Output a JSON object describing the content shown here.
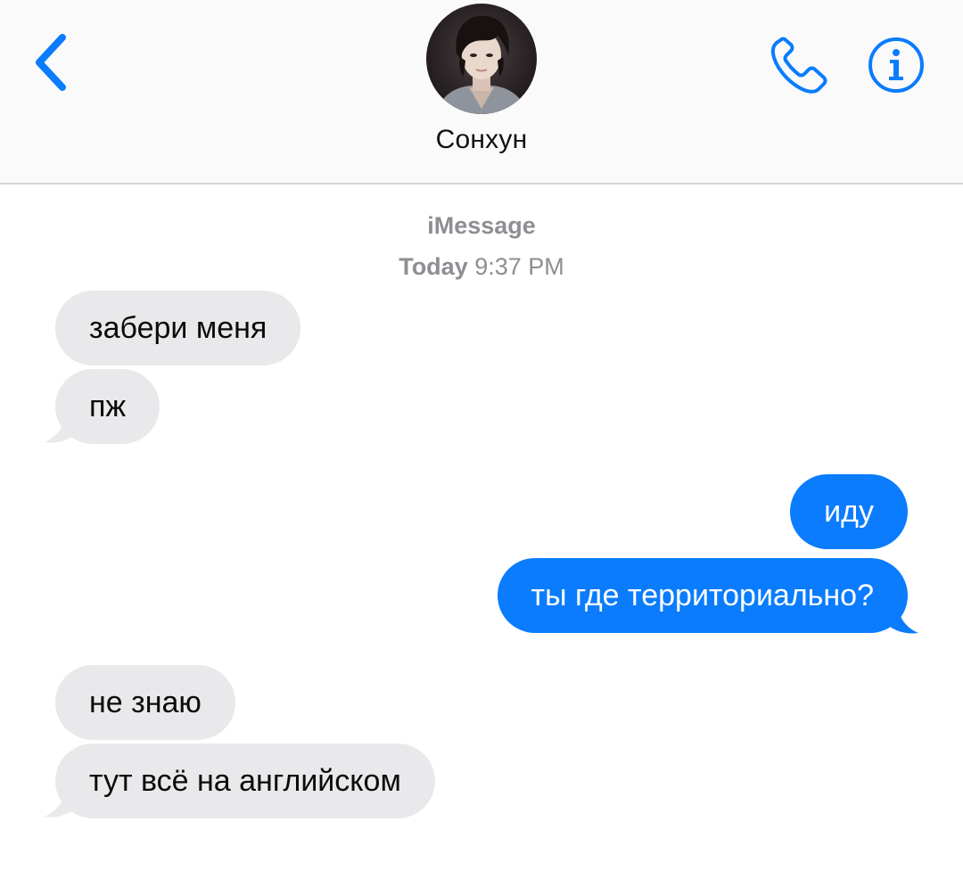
{
  "header": {
    "contact_name": "Сонхун",
    "back_icon": "chevron-left-icon",
    "call_icon": "phone-icon",
    "info_icon": "info-icon"
  },
  "conversation": {
    "service": "iMessage",
    "timestamp_day": "Today",
    "timestamp_time": "9:37 PM"
  },
  "messages": [
    {
      "direction": "incoming",
      "text": "забери меня"
    },
    {
      "direction": "incoming",
      "text": "пж"
    },
    {
      "direction": "outgoing",
      "text": "иду"
    },
    {
      "direction": "outgoing",
      "text": "ты где территориально?"
    },
    {
      "direction": "incoming",
      "text": "не знаю"
    },
    {
      "direction": "incoming",
      "text": "тут всё на английском"
    }
  ],
  "colors": {
    "accent": "#0a7cfd",
    "incoming_bubble": "#e9e9eb",
    "meta_text": "#8e8e93"
  }
}
